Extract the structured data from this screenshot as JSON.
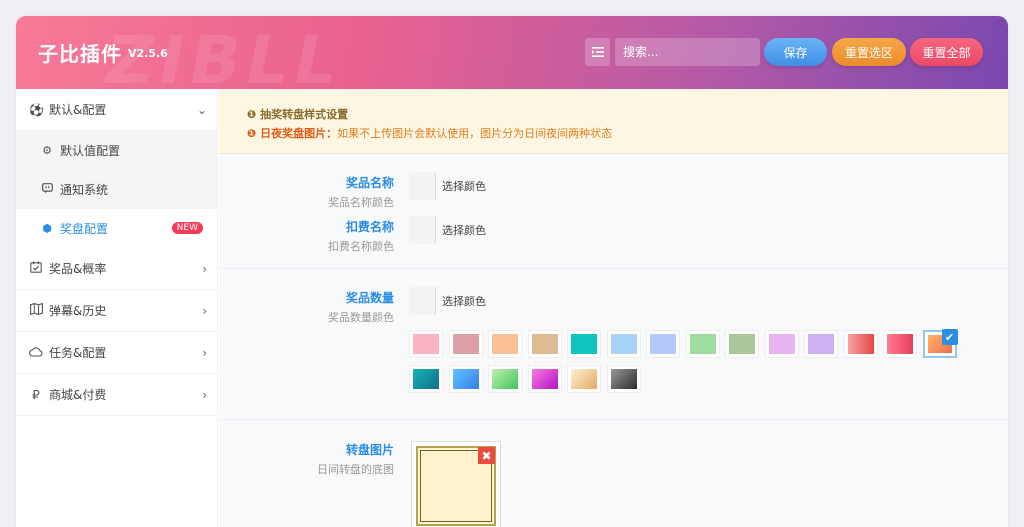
{
  "header": {
    "brand": "子比插件",
    "version": "V2.5.6",
    "watermark": "ZIBLL",
    "search_placeholder": "搜索...",
    "buttons": {
      "save": "保存",
      "reset_section": "重置选区",
      "reset_all": "重置全部"
    }
  },
  "sidebar": {
    "items": [
      {
        "label": "默认&配置",
        "icon": "soccer-ball-icon",
        "arrow": "⌄"
      },
      {
        "label": "奖品&概率",
        "icon": "calendar-check-icon",
        "arrow": "›"
      },
      {
        "label": "弹幕&历史",
        "icon": "map-icon",
        "arrow": "›"
      },
      {
        "label": "任务&配置",
        "icon": "cloud-icon",
        "arrow": "›"
      },
      {
        "label": "商城&付费",
        "icon": "ruble-icon",
        "arrow": "›"
      }
    ],
    "sub_items": [
      {
        "label": "默认值配置",
        "icon": "gear-icon"
      },
      {
        "label": "通知系统",
        "icon": "chat-icon"
      },
      {
        "label": "奖盘配置",
        "icon": "cube-icon",
        "badge": "NEW"
      }
    ]
  },
  "notice": {
    "title": "抽奖转盘样式设置",
    "line_bold": "日夜奖盘图片：",
    "line_text": "如果不上传图片会默认使用，图片分为日间夜间两种状态"
  },
  "fields": {
    "prize_name": {
      "title": "奖品名称",
      "sub": "奖品名称颜色",
      "picker": "选择颜色"
    },
    "cost_name": {
      "title": "扣费名称",
      "sub": "扣费名称颜色",
      "picker": "选择颜色"
    },
    "prize_count": {
      "title": "奖品数量",
      "sub": "奖品数量颜色",
      "picker": "选择颜色"
    },
    "wheel_image": {
      "title": "转盘图片",
      "sub": "日间转盘的底图"
    }
  },
  "presets": [
    {
      "name": "pink",
      "bg": "#f9b3c3"
    },
    {
      "name": "rose",
      "bg": "#dda0a5"
    },
    {
      "name": "peach",
      "bg": "#f9c094"
    },
    {
      "name": "tan",
      "bg": "#ddbc94"
    },
    {
      "name": "teal",
      "bg": "#0ec4bb"
    },
    {
      "name": "light-blue",
      "bg": "#a9d2f7"
    },
    {
      "name": "periwinkle",
      "bg": "#b4c9f7"
    },
    {
      "name": "mint",
      "bg": "#9edca0"
    },
    {
      "name": "sage",
      "bg": "#a9c99a"
    },
    {
      "name": "lavender",
      "bg": "#e8b5f2"
    },
    {
      "name": "lilac",
      "bg": "#cdb2f3"
    },
    {
      "name": "red-gradient",
      "bg": "linear-gradient(90deg,#f7a1a1,#e84545)"
    },
    {
      "name": "crimson-gradient",
      "bg": "linear-gradient(90deg,#ff7b91,#e8405e)"
    },
    {
      "name": "orange-gradient",
      "bg": "linear-gradient(135deg,#ffb36b,#f06f4a)",
      "selected": true
    },
    {
      "name": "teal-gradient",
      "bg": "linear-gradient(135deg,#12b4b4,#156e8c)"
    },
    {
      "name": "blue-gradient",
      "bg": "linear-gradient(135deg,#5fc2ff,#3a7fe8)"
    },
    {
      "name": "green-gradient",
      "bg": "linear-gradient(135deg,#bff0b0,#41c45a)"
    },
    {
      "name": "magenta-gradient",
      "bg": "linear-gradient(135deg,#ff79e0,#b014c4)"
    },
    {
      "name": "sand-gradient",
      "bg": "linear-gradient(135deg,#fff2d6,#e0a862)"
    },
    {
      "name": "gray-gradient",
      "bg": "linear-gradient(135deg,#9a9a9a,#2c2c2c)"
    }
  ]
}
